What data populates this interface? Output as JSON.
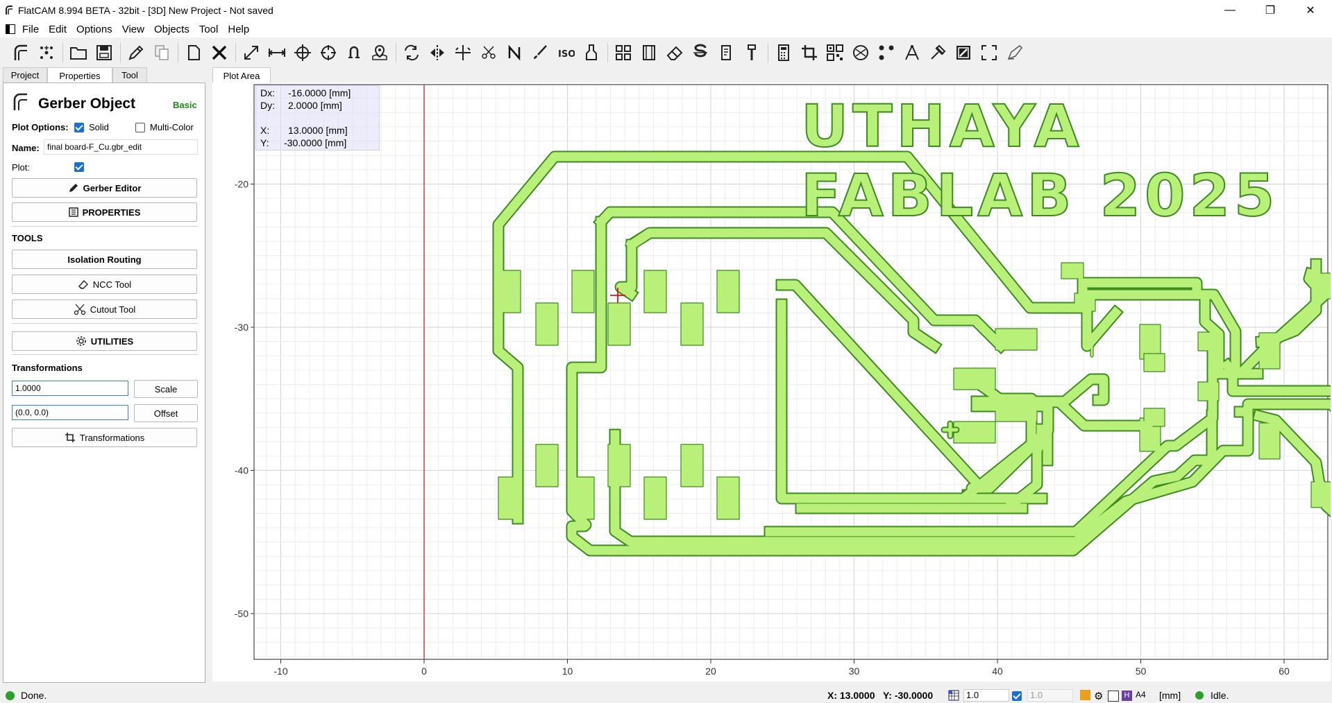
{
  "window": {
    "title": "FlatCAM 8.994 BETA - 32bit - [3D]    New Project - Not saved",
    "minimize": "—",
    "maximize": "❐",
    "close": "✕"
  },
  "menu": [
    "File",
    "Edit",
    "Options",
    "View",
    "Objects",
    "Tool",
    "Help"
  ],
  "left_tabs": [
    "Project",
    "Properties",
    "Tool"
  ],
  "panel": {
    "header": "Gerber Object",
    "level": "Basic",
    "plot_options_label": "Plot Options:",
    "solid_label": "Solid",
    "multicolor_label": "Multi-Color",
    "name_label": "Name:",
    "name_value": "final board-F_Cu.gbr_edit",
    "plot_label": "Plot:",
    "gerber_editor": "Gerber Editor",
    "properties": "PROPERTIES",
    "tools_heading": "TOOLS",
    "isolation": "Isolation Routing",
    "ncc": "NCC Tool",
    "cutout": "Cutout Tool",
    "utilities": "UTILITIES",
    "transformations_heading": "Transformations",
    "scale_value": "1.0000",
    "scale_btn": "Scale",
    "offset_value": "(0.0, 0.0)",
    "offset_btn": "Offset",
    "transformations_btn": "Transformations"
  },
  "plot_tab": "Plot Area",
  "coords_overlay": {
    "dx_label": "Dx:",
    "dx": "-16.0000 [mm]",
    "dy_label": "Dy:",
    "dy": "2.0000 [mm]",
    "x_label": "X:",
    "x": "13.0000 [mm]",
    "y_label": "Y:",
    "y": "-30.0000 [mm]"
  },
  "axes": {
    "x_ticks": [
      "-10",
      "0",
      "10",
      "20",
      "30",
      "40",
      "50",
      "60"
    ],
    "y_ticks": [
      "-20",
      "-30",
      "-40",
      "-50"
    ]
  },
  "board_text": {
    "line1": "UTHAYA",
    "line2": "FABLAB 2025"
  },
  "colors": {
    "copper_fill": "#b8f07a",
    "copper_edge": "#3d8a1f",
    "grid": "#e6e6e6",
    "axis": "#d04040",
    "status_ok": "#2aa02a"
  },
  "status": {
    "message": "Done.",
    "x": "X: 13.0000",
    "y": "Y: -30.0000",
    "grid_val": "1.0",
    "grid_val2": "1.0",
    "paper": "A4",
    "units": "[mm]",
    "state": "Idle."
  }
}
